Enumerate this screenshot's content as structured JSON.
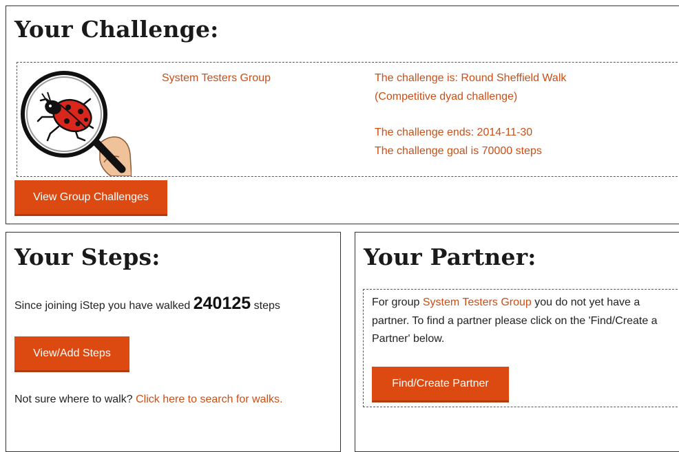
{
  "challenge": {
    "heading": "Your Challenge:",
    "group_name": "System Testers Group",
    "challenge_line": "The challenge is: Round Sheffield Walk",
    "challenge_type": "(Competitive dyad challenge)",
    "ends_line": "The challenge ends: 2014-11-30",
    "goal_line": "The challenge goal is 70000 steps",
    "image_icon": "ladybird-magnifier-icon",
    "view_button": "View Group Challenges"
  },
  "steps": {
    "heading": "Your Steps:",
    "prefix": "Since joining iStep you have walked",
    "count": "240125",
    "suffix": "steps",
    "button": "View/Add Steps",
    "walk_prompt": "Not sure where to walk?",
    "walk_link": "Click here to search for walks."
  },
  "partner": {
    "heading": "Your Partner:",
    "text_before": "For group",
    "group_link": "System Testers Group",
    "text_after": "you do not yet have a partner. To find a partner please click on the 'Find/Create a Partner' below.",
    "button": "Find/Create Partner"
  },
  "colors": {
    "accent": "#dc4a12",
    "link": "#cc4e14"
  }
}
